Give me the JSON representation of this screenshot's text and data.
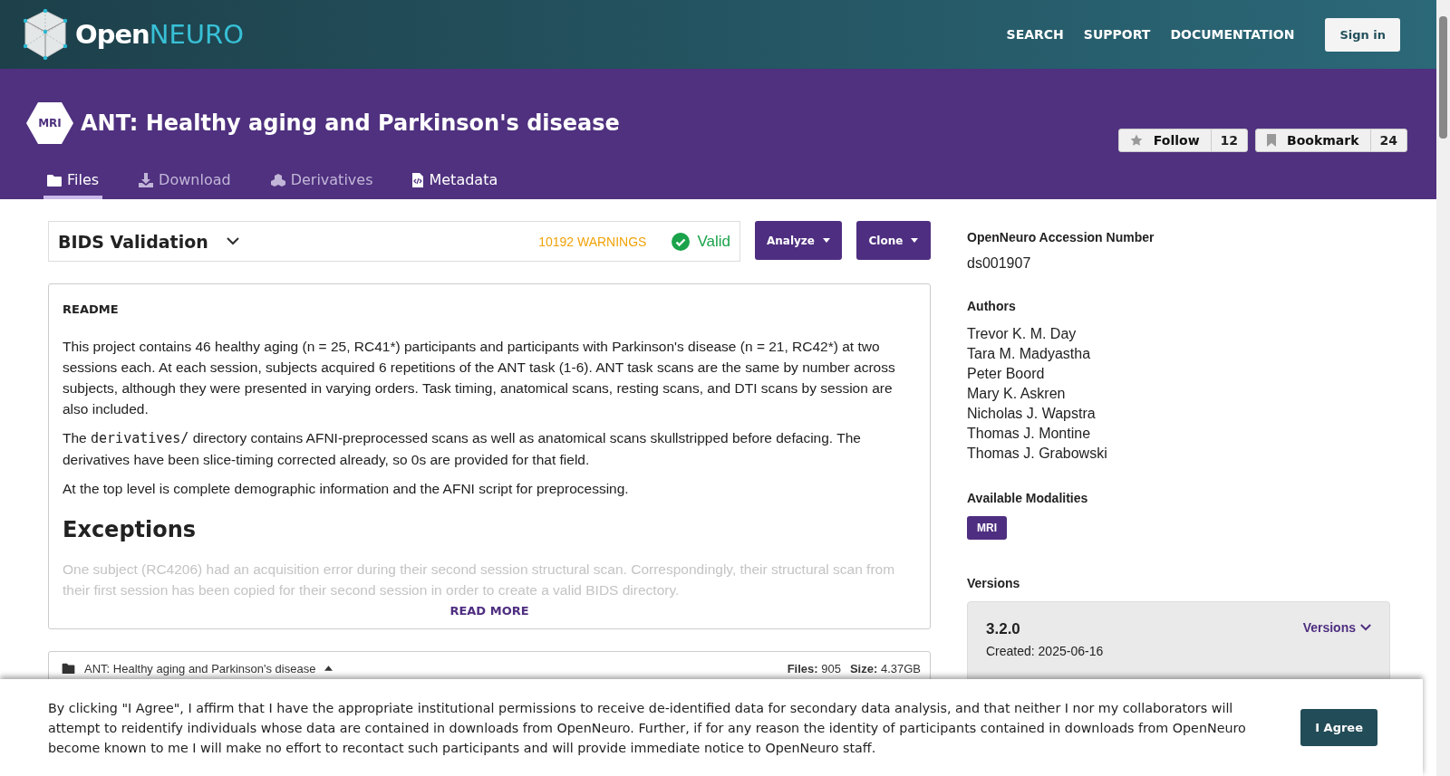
{
  "header": {
    "logo": {
      "strong": "Open",
      "light": "NEURO"
    },
    "nav": [
      "SEARCH",
      "SUPPORT",
      "DOCUMENTATION"
    ],
    "sign_in": "Sign in"
  },
  "dataset": {
    "modality": "MRI",
    "title": "ANT: Healthy aging and Parkinson's disease",
    "counters": [
      {
        "kind": "star",
        "label": "Follow",
        "count": "12"
      },
      {
        "kind": "bookmark",
        "label": "Bookmark",
        "count": "24"
      }
    ],
    "tabs": [
      {
        "label": "Files",
        "selected": true,
        "disabled": false
      },
      {
        "label": "Download",
        "selected": false,
        "disabled": true
      },
      {
        "label": "Derivatives",
        "selected": false,
        "disabled": true
      },
      {
        "label": "Metadata",
        "selected": false,
        "disabled": false
      }
    ]
  },
  "validation": {
    "title": "BIDS Validation",
    "warnings": "10192 WARNINGS",
    "status": "Valid",
    "valid": true
  },
  "actions": [
    "Analyze",
    "Clone"
  ],
  "readme": {
    "heading": "README",
    "paragraphs": [
      {
        "text": "This project contains 46 healthy aging (n = 25, RC41*) participants and participants with Parkinson's disease (n = 21, RC42*) at two sessions each. At each session, subjects acquired 6 repetitions of the ANT task (1-6). ANT task scans are the same by number across subjects, although they were presented in varying orders. Task timing, anatomical scans, resting scans, and DTI scans by session are also included."
      },
      {
        "before": "The ",
        "code": "derivatives/",
        "after": " directory contains AFNI-preprocessed scans as well as anatomical scans skullstripped before defacing. The derivatives have been slice-timing corrected already, so 0s are provided for that field."
      },
      {
        "text": "At the top level is complete demographic information and the AFNI script for preprocessing."
      }
    ],
    "section": "Exceptions",
    "faded": "One subject (RC4206) had an acquisition error during their second session structural scan. Correspondingly, their structural scan from their first session has been copied for their second session in order to create a valid BIDS directory.",
    "read_more": "READ MORE"
  },
  "file_tree": {
    "name": "ANT: Healthy aging and Parkinson's disease",
    "files_label": "Files:",
    "files": "905",
    "size_label": "Size:",
    "size": "4.37GB"
  },
  "sidebar": {
    "accession_heading": "OpenNeuro Accession Number",
    "accession": "ds001907",
    "authors_heading": "Authors",
    "authors": [
      "Trevor K. M. Day",
      "Tara M. Madyastha",
      "Peter Boord",
      "Mary K. Askren",
      "Nicholas J. Wapstra",
      "Thomas J. Montine",
      "Thomas J. Grabowski"
    ],
    "modalities_heading": "Available Modalities",
    "modalities": [
      "MRI"
    ],
    "versions_heading": "Versions",
    "version": "3.2.0",
    "created": "Created: 2025-06-16",
    "versions_button": "Versions"
  },
  "consent": {
    "text": "By clicking \"I Agree\", I affirm that I have the appropriate institutional permissions to receive de-identified data for secondary data analysis, and that neither I nor my collaborators will attempt to reidentify individuals whose data are contained in downloads from OpenNeuro. Further, if for any reason the identity of participants contained in downloads from OpenNeuro become known to me I will make no effort to recontact such participants and will provide immediate notice to OpenNeuro staff.",
    "button": "I Agree"
  }
}
